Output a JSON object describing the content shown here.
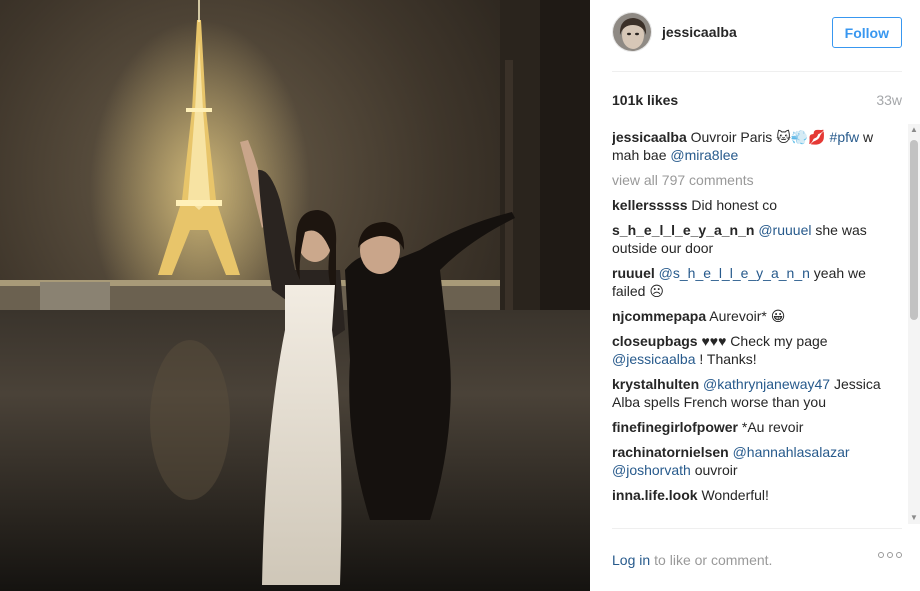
{
  "post": {
    "username": "jessicaalba",
    "follow_label": "Follow",
    "likes": "101k likes",
    "time_ago": "33w"
  },
  "caption": {
    "username": "jessicaalba",
    "text_1": "Ouvroir Paris 🐱💨💋",
    "hashtag": "#pfw",
    "text_2": "w mah bae",
    "mention": "@mira8lee"
  },
  "view_all": "view all 797 comments",
  "comments": [
    {
      "user": "kellersssss",
      "pre": "Did honest co",
      "link": "",
      "post": ""
    },
    {
      "user": "s_h_e_l_l_e_y_a_n_n",
      "pre": "",
      "link": "@ruuuel",
      "post": "she was outside our door"
    },
    {
      "user": "ruuuel",
      "pre": "",
      "link": "@s_h_e_l_l_e_y_a_n_n",
      "post": "yeah we failed ☹"
    },
    {
      "user": "njcommepapa",
      "pre": "Aurevoir* 😀",
      "link": "",
      "post": ""
    },
    {
      "user": "closeupbags",
      "pre": "♥♥♥ Check my page",
      "link": "@jessicaalba",
      "post": "! Thanks!"
    },
    {
      "user": "krystalhulten",
      "pre": "",
      "link": "@kathrynjaneway47",
      "post": "Jessica Alba spells French worse than you"
    },
    {
      "user": "finefinegirlofpower",
      "pre": "*Au revoir",
      "link": "",
      "post": ""
    },
    {
      "user": "rachinatornielsen",
      "pre": "",
      "link": "@hannahlasalazar @joshorvath",
      "post": "ouvroir"
    },
    {
      "user": "inna.life.look",
      "pre": "Wonderful!",
      "link": "",
      "post": ""
    }
  ],
  "footer": {
    "login_label": "Log in",
    "login_rest": "to like or comment."
  },
  "icons": {
    "more": "more-options-icon",
    "scroll_up": "scroll-up-arrow-icon",
    "scroll_down": "scroll-down-arrow-icon"
  },
  "colors": {
    "accent": "#3897f0",
    "link": "#275a8c",
    "muted": "#999999"
  }
}
